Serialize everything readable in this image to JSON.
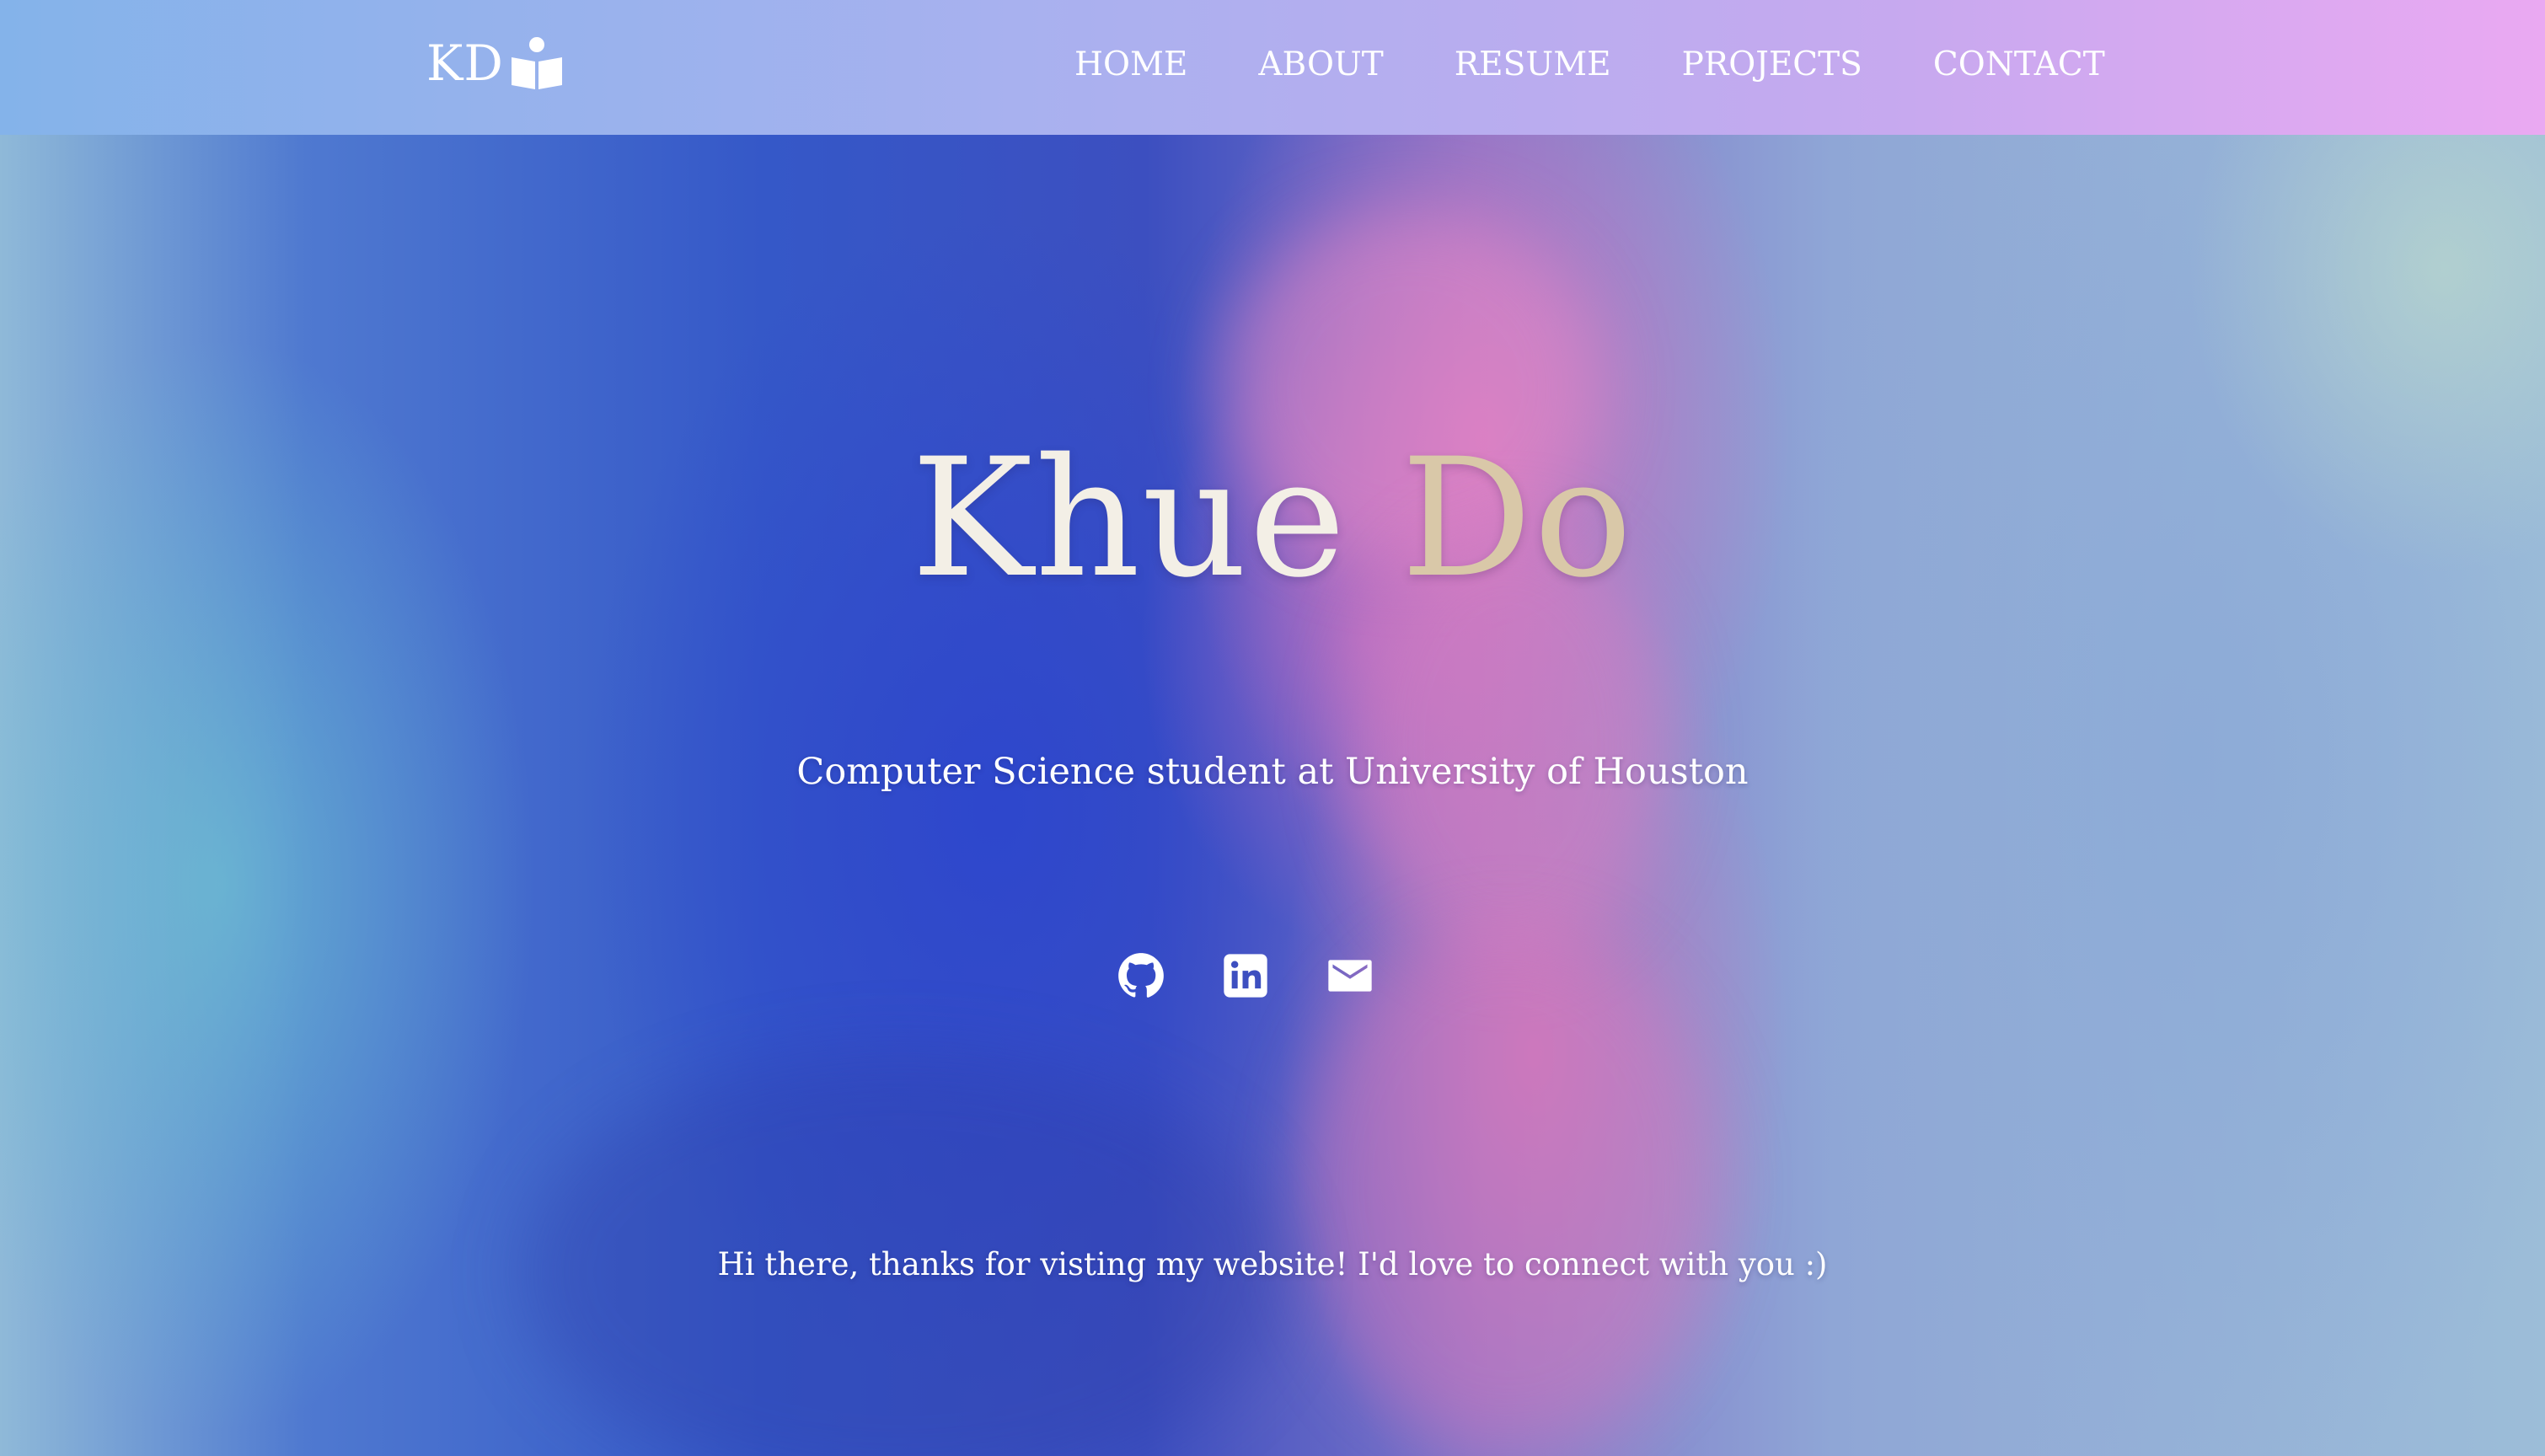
{
  "nav": {
    "brand": "KD",
    "brand_icon": "reader-book-icon",
    "links": [
      {
        "label": "HOME"
      },
      {
        "label": "ABOUT"
      },
      {
        "label": "RESUME"
      },
      {
        "label": "PROJECTS"
      },
      {
        "label": "CONTACT"
      }
    ]
  },
  "hero": {
    "name_first": "Khue",
    "name_last": "Do",
    "subtitle": "Computer Science student at University of Houston",
    "social": [
      {
        "icon": "github-icon"
      },
      {
        "icon": "linkedin-icon"
      },
      {
        "icon": "email-icon"
      }
    ],
    "greeting": "Hi there, thanks for visting my website! I'd love to connect with you :)"
  },
  "colors": {
    "nav_gradient_start": "#84b3ea",
    "nav_gradient_end": "#eaa9f2",
    "name_first": "#f3efe6",
    "name_last": "#d9c8a8",
    "text": "#ffffff"
  }
}
